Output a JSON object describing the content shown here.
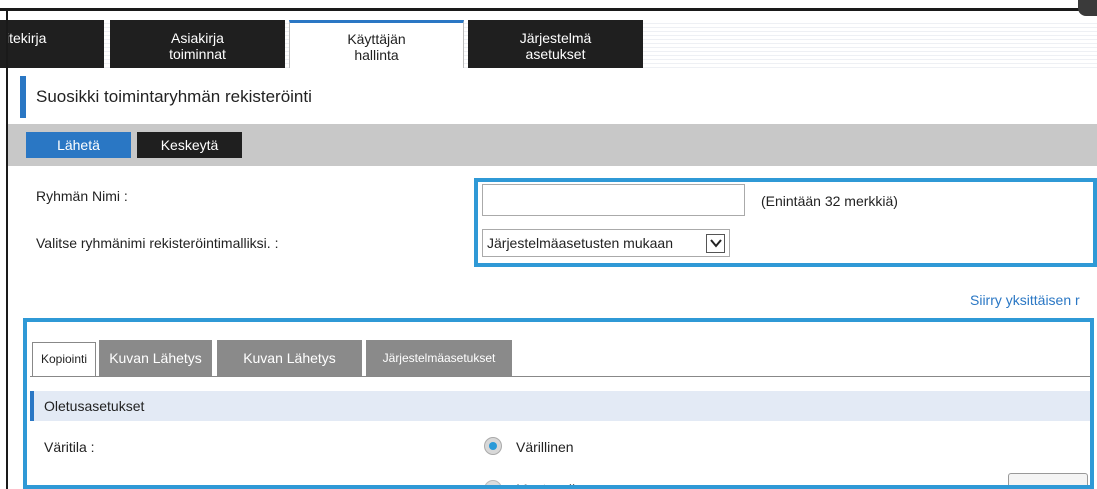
{
  "top_tabs": [
    {
      "label_line1": "itekirja",
      "label_line2": ""
    },
    {
      "label_line1": "Asiakirja",
      "label_line2": "toiminnat"
    },
    {
      "label_line1": "Käyttäjän",
      "label_line2": "hallinta"
    },
    {
      "label_line1": "Järjestelmä",
      "label_line2": "asetukset"
    }
  ],
  "page_title": "Suosikki toimintaryhmän rekisteröinti",
  "actions": {
    "send_label": "Lähetä",
    "pause_label": "Keskeytä"
  },
  "form": {
    "group_name_label": "Ryhmän Nimi :",
    "group_name_value": "",
    "group_name_hint": "(Enintään 32 merkkiä)",
    "template_label": "Valitse ryhmänimi rekisteröintimalliksi. :",
    "template_selected": "Järjestelmäasetusten mukaan"
  },
  "individual_link": "Siirry yksittäisen r",
  "inner_tabs": [
    "Kopiointi",
    "Kuvan Lähetys",
    "Kuvan Lähetys",
    "Järjestelmäasetukset"
  ],
  "section_title": "Oletusasetukset",
  "color_mode": {
    "label": "Väritila :",
    "option1": "Värillinen",
    "option2": "Mustavalko"
  },
  "colors": {
    "accent": "#2a77c4",
    "highlight": "#2f99d6",
    "tab_dark": "#1f1f1f",
    "action_bar": "#c8c8c8"
  }
}
